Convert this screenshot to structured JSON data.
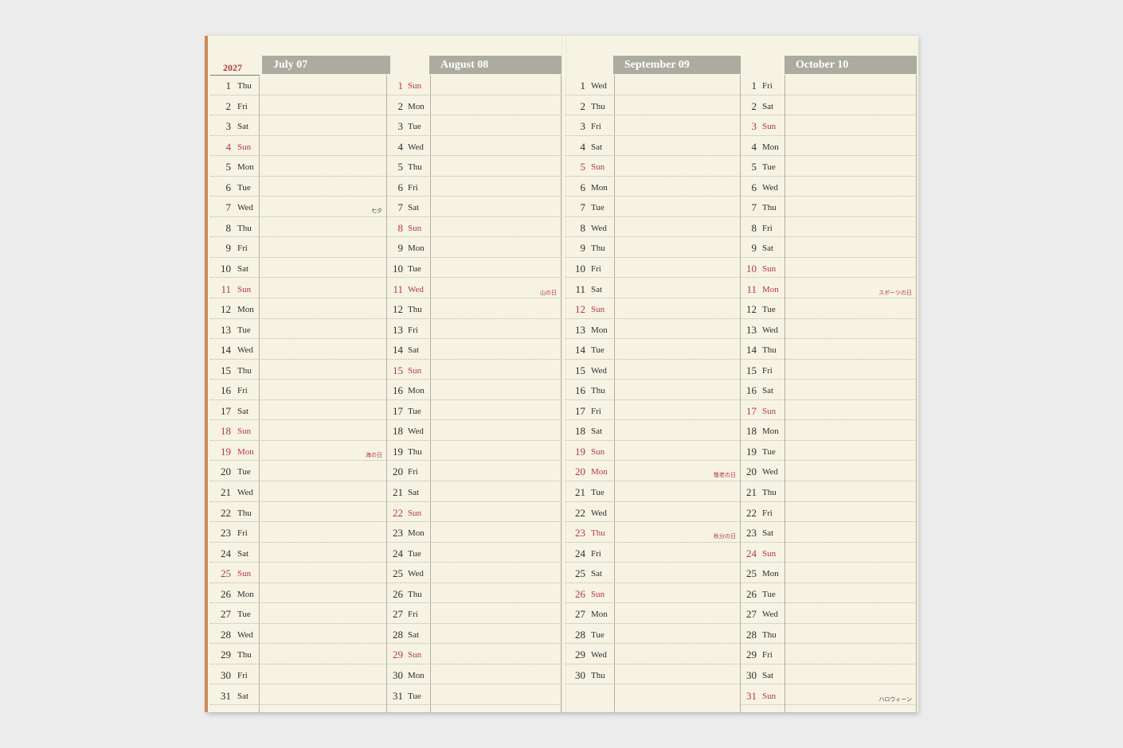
{
  "year": "2027",
  "months": [
    {
      "label": "July 07",
      "days": [
        {
          "n": "1",
          "d": "Thu"
        },
        {
          "n": "2",
          "d": "Fri"
        },
        {
          "n": "3",
          "d": "Sat"
        },
        {
          "n": "4",
          "d": "Sun",
          "red": true
        },
        {
          "n": "5",
          "d": "Mon"
        },
        {
          "n": "6",
          "d": "Tue"
        },
        {
          "n": "7",
          "d": "Wed",
          "note": "七夕"
        },
        {
          "n": "8",
          "d": "Thu"
        },
        {
          "n": "9",
          "d": "Fri"
        },
        {
          "n": "10",
          "d": "Sat"
        },
        {
          "n": "11",
          "d": "Sun",
          "red": true
        },
        {
          "n": "12",
          "d": "Mon"
        },
        {
          "n": "13",
          "d": "Tue"
        },
        {
          "n": "14",
          "d": "Wed"
        },
        {
          "n": "15",
          "d": "Thu"
        },
        {
          "n": "16",
          "d": "Fri"
        },
        {
          "n": "17",
          "d": "Sat"
        },
        {
          "n": "18",
          "d": "Sun",
          "red": true
        },
        {
          "n": "19",
          "d": "Mon",
          "red": true,
          "note": "海の日",
          "noteRed": true
        },
        {
          "n": "20",
          "d": "Tue"
        },
        {
          "n": "21",
          "d": "Wed"
        },
        {
          "n": "22",
          "d": "Thu"
        },
        {
          "n": "23",
          "d": "Fri"
        },
        {
          "n": "24",
          "d": "Sat"
        },
        {
          "n": "25",
          "d": "Sun",
          "red": true
        },
        {
          "n": "26",
          "d": "Mon"
        },
        {
          "n": "27",
          "d": "Tue"
        },
        {
          "n": "28",
          "d": "Wed"
        },
        {
          "n": "29",
          "d": "Thu"
        },
        {
          "n": "30",
          "d": "Fri"
        },
        {
          "n": "31",
          "d": "Sat"
        }
      ]
    },
    {
      "label": "August 08",
      "days": [
        {
          "n": "1",
          "d": "Sun",
          "red": true
        },
        {
          "n": "2",
          "d": "Mon"
        },
        {
          "n": "3",
          "d": "Tue"
        },
        {
          "n": "4",
          "d": "Wed"
        },
        {
          "n": "5",
          "d": "Thu"
        },
        {
          "n": "6",
          "d": "Fri"
        },
        {
          "n": "7",
          "d": "Sat"
        },
        {
          "n": "8",
          "d": "Sun",
          "red": true
        },
        {
          "n": "9",
          "d": "Mon"
        },
        {
          "n": "10",
          "d": "Tue"
        },
        {
          "n": "11",
          "d": "Wed",
          "red": true,
          "note": "山の日",
          "noteRed": true
        },
        {
          "n": "12",
          "d": "Thu"
        },
        {
          "n": "13",
          "d": "Fri"
        },
        {
          "n": "14",
          "d": "Sat"
        },
        {
          "n": "15",
          "d": "Sun",
          "red": true
        },
        {
          "n": "16",
          "d": "Mon"
        },
        {
          "n": "17",
          "d": "Tue"
        },
        {
          "n": "18",
          "d": "Wed"
        },
        {
          "n": "19",
          "d": "Thu"
        },
        {
          "n": "20",
          "d": "Fri"
        },
        {
          "n": "21",
          "d": "Sat"
        },
        {
          "n": "22",
          "d": "Sun",
          "red": true
        },
        {
          "n": "23",
          "d": "Mon"
        },
        {
          "n": "24",
          "d": "Tue"
        },
        {
          "n": "25",
          "d": "Wed"
        },
        {
          "n": "26",
          "d": "Thu"
        },
        {
          "n": "27",
          "d": "Fri"
        },
        {
          "n": "28",
          "d": "Sat"
        },
        {
          "n": "29",
          "d": "Sun",
          "red": true
        },
        {
          "n": "30",
          "d": "Mon"
        },
        {
          "n": "31",
          "d": "Tue"
        }
      ]
    },
    {
      "label": "September 09",
      "days": [
        {
          "n": "1",
          "d": "Wed"
        },
        {
          "n": "2",
          "d": "Thu"
        },
        {
          "n": "3",
          "d": "Fri"
        },
        {
          "n": "4",
          "d": "Sat"
        },
        {
          "n": "5",
          "d": "Sun",
          "red": true
        },
        {
          "n": "6",
          "d": "Mon"
        },
        {
          "n": "7",
          "d": "Tue"
        },
        {
          "n": "8",
          "d": "Wed"
        },
        {
          "n": "9",
          "d": "Thu"
        },
        {
          "n": "10",
          "d": "Fri"
        },
        {
          "n": "11",
          "d": "Sat"
        },
        {
          "n": "12",
          "d": "Sun",
          "red": true
        },
        {
          "n": "13",
          "d": "Mon"
        },
        {
          "n": "14",
          "d": "Tue"
        },
        {
          "n": "15",
          "d": "Wed"
        },
        {
          "n": "16",
          "d": "Thu"
        },
        {
          "n": "17",
          "d": "Fri"
        },
        {
          "n": "18",
          "d": "Sat"
        },
        {
          "n": "19",
          "d": "Sun",
          "red": true
        },
        {
          "n": "20",
          "d": "Mon",
          "red": true,
          "note": "敬老の日",
          "noteRed": true
        },
        {
          "n": "21",
          "d": "Tue"
        },
        {
          "n": "22",
          "d": "Wed"
        },
        {
          "n": "23",
          "d": "Thu",
          "red": true,
          "note": "秋分の日",
          "noteRed": true
        },
        {
          "n": "24",
          "d": "Fri"
        },
        {
          "n": "25",
          "d": "Sat"
        },
        {
          "n": "26",
          "d": "Sun",
          "red": true
        },
        {
          "n": "27",
          "d": "Mon"
        },
        {
          "n": "28",
          "d": "Tue"
        },
        {
          "n": "29",
          "d": "Wed"
        },
        {
          "n": "30",
          "d": "Thu"
        }
      ]
    },
    {
      "label": "October 10",
      "days": [
        {
          "n": "1",
          "d": "Fri"
        },
        {
          "n": "2",
          "d": "Sat"
        },
        {
          "n": "3",
          "d": "Sun",
          "red": true
        },
        {
          "n": "4",
          "d": "Mon"
        },
        {
          "n": "5",
          "d": "Tue"
        },
        {
          "n": "6",
          "d": "Wed"
        },
        {
          "n": "7",
          "d": "Thu"
        },
        {
          "n": "8",
          "d": "Fri"
        },
        {
          "n": "9",
          "d": "Sat"
        },
        {
          "n": "10",
          "d": "Sun",
          "red": true
        },
        {
          "n": "11",
          "d": "Mon",
          "red": true,
          "note": "スポーツの日",
          "noteRed": true
        },
        {
          "n": "12",
          "d": "Tue"
        },
        {
          "n": "13",
          "d": "Wed"
        },
        {
          "n": "14",
          "d": "Thu"
        },
        {
          "n": "15",
          "d": "Fri"
        },
        {
          "n": "16",
          "d": "Sat"
        },
        {
          "n": "17",
          "d": "Sun",
          "red": true
        },
        {
          "n": "18",
          "d": "Mon"
        },
        {
          "n": "19",
          "d": "Tue"
        },
        {
          "n": "20",
          "d": "Wed"
        },
        {
          "n": "21",
          "d": "Thu"
        },
        {
          "n": "22",
          "d": "Fri"
        },
        {
          "n": "23",
          "d": "Sat"
        },
        {
          "n": "24",
          "d": "Sun",
          "red": true
        },
        {
          "n": "25",
          "d": "Mon"
        },
        {
          "n": "26",
          "d": "Tue"
        },
        {
          "n": "27",
          "d": "Wed"
        },
        {
          "n": "28",
          "d": "Thu"
        },
        {
          "n": "29",
          "d": "Fri"
        },
        {
          "n": "30",
          "d": "Sat"
        },
        {
          "n": "31",
          "d": "Sun",
          "red": true,
          "note": "ハロウィーン"
        }
      ]
    }
  ]
}
